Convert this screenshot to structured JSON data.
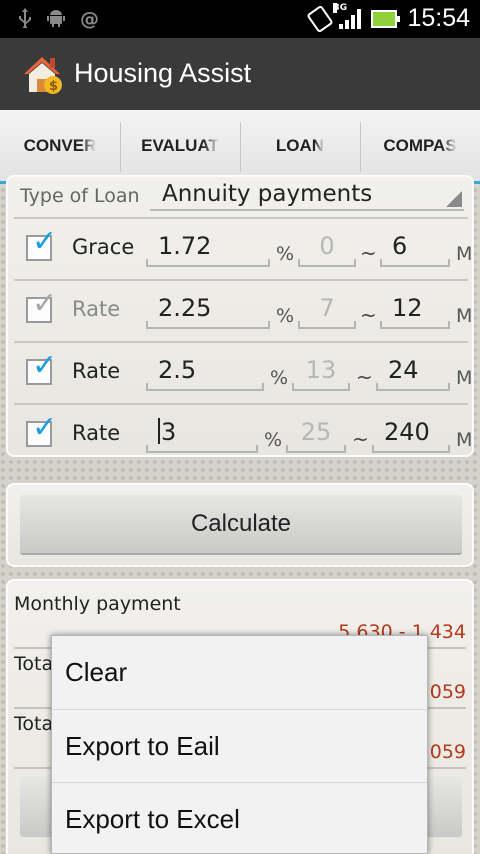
{
  "status_bar": {
    "time": "15:54",
    "network_type": "3G",
    "left_icons": [
      "usb-icon",
      "android-debug-icon",
      "at-sign-icon"
    ],
    "right_icons": [
      "screen-rotation-icon",
      "signal-icon",
      "battery-charging-icon"
    ]
  },
  "app": {
    "title": "Housing Assist",
    "icon": "house-dollar-icon"
  },
  "tabs": [
    {
      "label": "CONVERSION",
      "display": "CONVER"
    },
    {
      "label": "EVALUATION",
      "display": "EVALUAT"
    },
    {
      "label": "LOAN",
      "display": "LOAN",
      "active": true
    },
    {
      "label": "COMPASS",
      "display": "COMPAS"
    }
  ],
  "loan": {
    "type_label": "Type of Loan",
    "type_value": "Annuity payments",
    "percent_unit": "%",
    "month_unit": "M",
    "range_separator": "~",
    "rows": [
      {
        "checked": true,
        "enabled": true,
        "label": "Grace",
        "rate": "1.72",
        "from": "0",
        "to": "6"
      },
      {
        "checked": true,
        "enabled": false,
        "label": "Rate",
        "rate": "2.25",
        "from": "7",
        "to": "12"
      },
      {
        "checked": true,
        "enabled": true,
        "label": "Rate",
        "rate": "2.5",
        "from": "13",
        "to": "24"
      },
      {
        "checked": true,
        "enabled": true,
        "label": "Rate",
        "rate": "3",
        "from": "25",
        "to": "240"
      }
    ]
  },
  "calculate_label": "Calculate",
  "results": {
    "monthly_label": "Monthly payment",
    "monthly_value": "5,630 - 1,434",
    "total1_label": "Tota",
    "total1_value": ",059",
    "total2_label": "Tota",
    "total2_value": ",059"
  },
  "popup_menu": {
    "items": [
      "Clear",
      "Export to Eail",
      "Export to Excel"
    ]
  },
  "colors": {
    "accent": "#3aa7d6",
    "result_red": "#b33a1c",
    "action_bar": "#3a3a3a"
  }
}
